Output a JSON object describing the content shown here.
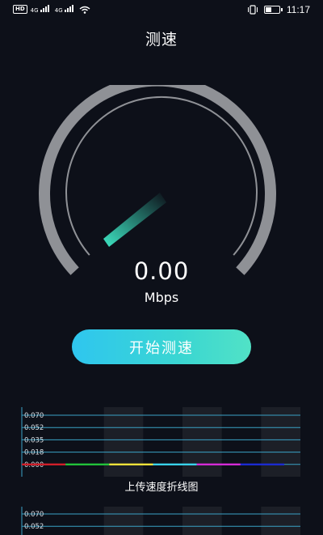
{
  "status_bar": {
    "left_icons": [
      "hd-icon",
      "4g-signal-icon",
      "4g-signal-icon",
      "wifi-icon"
    ],
    "hd_label": "HD",
    "net_label_1": "4G",
    "net_label_2": "4G",
    "time": "11:17",
    "battery_level": 0.45
  },
  "header": {
    "title": "测速"
  },
  "gauge": {
    "value": "0.00",
    "unit": "Mbps",
    "needle_fraction": 0.0
  },
  "start_button": {
    "label": "开始测速"
  },
  "colors": {
    "background": "#0d1019",
    "button_gradient_start": "#2fc6ef",
    "button_gradient_end": "#51e2c6",
    "gauge_arc": "#8f9196",
    "gauge_needle": "#3ee6c4",
    "chart_line": "#3aa2c6"
  },
  "chart_data": [
    {
      "type": "line",
      "title": "上传速度折线图",
      "y_ticks": [
        "0.070",
        "0.052",
        "0.035",
        "0.018",
        "0.000"
      ],
      "ylim": [
        0,
        0.07
      ],
      "grid": true,
      "bands": 3,
      "x_segments": 6,
      "series": [
        {
          "values": [
            0,
            0,
            0,
            0,
            0,
            0,
            0
          ]
        }
      ],
      "segment_colors": [
        "#d01f2a",
        "#22c23a",
        "#f2e23a",
        "#39d2ea",
        "#d42bd6",
        "#1b2bd0"
      ]
    },
    {
      "type": "line",
      "y_ticks": [
        "0.070",
        "0.052"
      ],
      "ylim": [
        0,
        0.07
      ],
      "grid": true
    }
  ]
}
